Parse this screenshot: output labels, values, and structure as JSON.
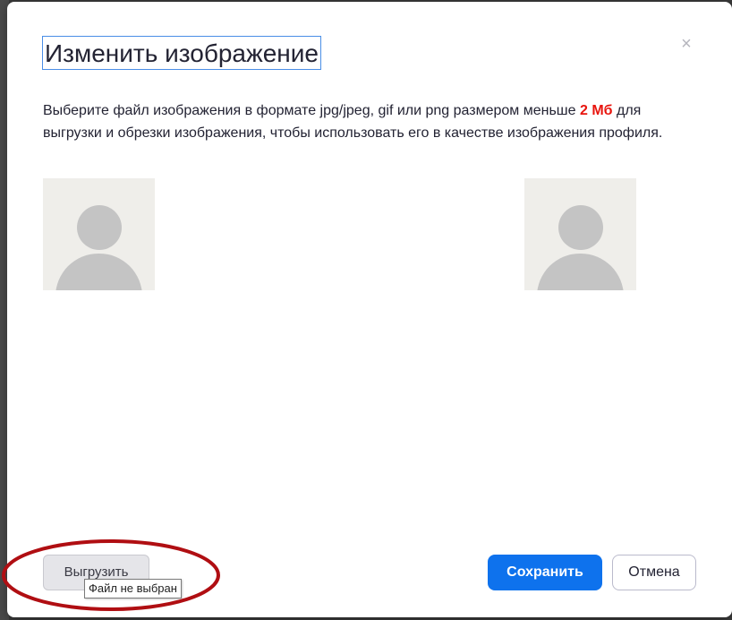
{
  "dialog": {
    "title": "Изменить изображение",
    "close_icon": "close-icon",
    "description_before": "Выберите файл изображения в формате jpg/jpeg, gif или png размером меньше ",
    "description_limit": "2 Мб",
    "description_after": " для выгрузки и обрезки изображения, чтобы использовать его в качестве изображения профиля.",
    "limit_color": "#e8140d"
  },
  "images": {
    "original_placeholder": "avatar-placeholder-icon",
    "preview_placeholder": "avatar-placeholder-icon"
  },
  "actions": {
    "upload_label": "Выгрузить",
    "upload_tooltip": "Файл не выбран",
    "save_label": "Сохранить",
    "cancel_label": "Отмена",
    "primary_color": "#0e72ed",
    "annotation_color": "#b00e12"
  }
}
